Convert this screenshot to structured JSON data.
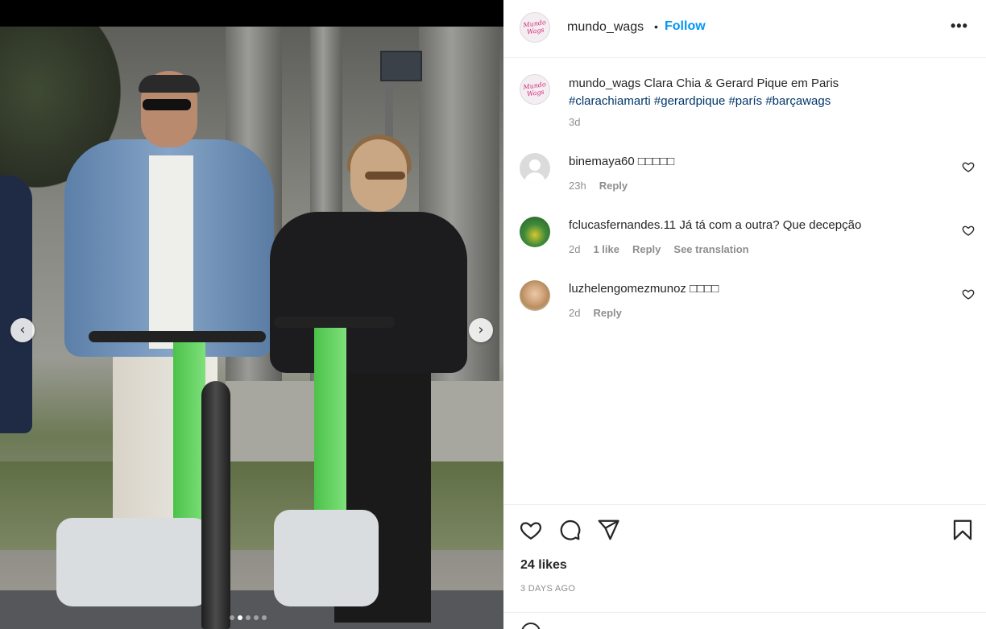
{
  "post": {
    "username": "mundo_wags",
    "separator": "•",
    "follow_label": "Follow",
    "more_label": "•••",
    "avatar_text_line1": "Mundo",
    "avatar_text_line2": "Wags"
  },
  "caption": {
    "username": "mundo_wags",
    "text": "Clara Chia & Gerard Pique em Paris",
    "hashtags": [
      "#clarachiamarti",
      "#gerardpique",
      "#parís",
      "#barçawags"
    ],
    "time": "3d"
  },
  "comments": [
    {
      "username": "binemaya60",
      "text": "□□□□□",
      "time": "23h",
      "likes": "",
      "reply_label": "Reply",
      "translation_label": ""
    },
    {
      "username": "fclucasfernandes.11",
      "text": "Já tá com a outra? Que decepção",
      "time": "2d",
      "likes": "1 like",
      "reply_label": "Reply",
      "translation_label": "See translation"
    },
    {
      "username": "luzhelengomezmunoz",
      "text": "□□□□",
      "time": "2d",
      "likes": "",
      "reply_label": "Reply",
      "translation_label": ""
    }
  ],
  "engagement": {
    "likes": "24 likes",
    "date": "3 DAYS AGO"
  },
  "carousel": {
    "prev_icon": "chevron-left-icon",
    "next_icon": "chevron-right-icon",
    "slide_count": 5,
    "active_slide": 1
  },
  "colors": {
    "follow": "#0095f6",
    "hashtag": "#00376b",
    "meta": "#8e8e8e",
    "text": "#262626"
  }
}
